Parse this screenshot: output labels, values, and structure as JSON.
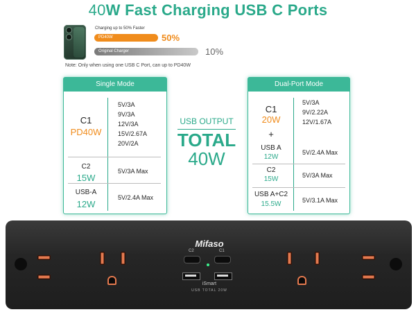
{
  "title": {
    "prefix": "40",
    "rest": "W Fast Charging USB C Ports"
  },
  "compare": {
    "caption": "Charging up to 50% Faster",
    "bar1_label": "PD40W",
    "bar1_pct": "50%",
    "bar2_label": "Original Charger",
    "bar2_pct": "10%",
    "note": "Note: Only when using one USB C Port, can up to PD40W"
  },
  "single": {
    "header": "Single Mode",
    "c1_name": "C1",
    "c1_power": "PD40W",
    "c1_specs": [
      "5V/3A",
      "9V/3A",
      "12V/3A",
      "15V/2.67A",
      "20V/2A"
    ],
    "c2_name": "C2",
    "c2_power": "15W",
    "c2_spec": "5V/3A Max",
    "a_name": "USB-A",
    "a_power": "12W",
    "a_spec": "5V/2.4A Max"
  },
  "center": {
    "usb_output": "USB OUTPUT",
    "total": "TOTAL",
    "watts": "40W"
  },
  "dual": {
    "header": "Dual-Port Mode",
    "c1_name": "C1",
    "c1_power": "20W",
    "c1_specs": [
      "5V/3A",
      "9V/2.22A",
      "12V/1.67A"
    ],
    "plus": "+",
    "a_name": "USB A",
    "a_power": "12W",
    "a_spec": "5V/2.4A Max",
    "c2_name": "C2",
    "c2_power": "15W",
    "c2_spec": "5V/3A Max",
    "ac2_name": "USB A+C2",
    "ac2_power": "15.5W",
    "ac2_spec": "5V/3.1A Max"
  },
  "strip": {
    "brand": "Mifaso",
    "port_c2": "C2",
    "port_c1": "C1",
    "ismart": "iSmart",
    "usb_total": "USB TOTAL 20W"
  },
  "colors": {
    "accent": "#3cb898",
    "orange": "#f08c1c"
  }
}
